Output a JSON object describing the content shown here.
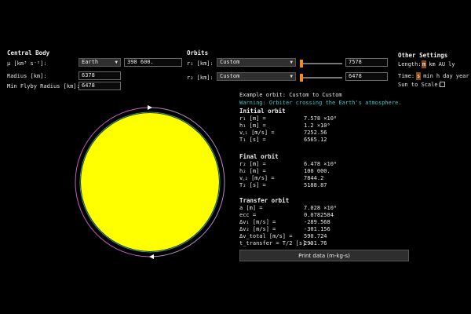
{
  "central_body": {
    "header": "Central Body",
    "mu_label": "μ [km³ s⁻²]:",
    "body_selected": "Earth",
    "mu_value": "398 600.",
    "radius_label": "Radius [km]:",
    "radius_value": "6378",
    "flyby_label": "Min Flyby Radius [km]:",
    "flyby_value": "6478"
  },
  "orbits": {
    "header": "Orbits",
    "r1_label": "r₁ [km]:",
    "r1_preset": "Custom",
    "r1_value": "7578",
    "r2_label": "r₂ [km]:",
    "r2_preset": "Custom",
    "r2_value": "6478"
  },
  "other": {
    "header": "Other Settings",
    "length_label": "Length:",
    "length_units": [
      "m",
      "km",
      "AU",
      "ly"
    ],
    "length_selected": "m",
    "time_label": "Time:",
    "time_units": [
      "s",
      "min",
      "h",
      "day",
      "year"
    ],
    "time_selected": "s",
    "sun_label": "Sun to Scale:",
    "sun_checked": false
  },
  "results": {
    "example": "Example orbit: Custom to Custom",
    "warning": "Warning: Orbiter crossing the Earth's atmosphere.",
    "initial": {
      "header": "Initial orbit",
      "rows": [
        {
          "k": "r₁ [m] =",
          "v": "7.578 ×10⁶"
        },
        {
          "k": "h₁ [m] =",
          "v": "1.2 ×10⁶"
        },
        {
          "k": "v꜀₁ [m/s] =",
          "v": "7252.56"
        },
        {
          "k": "T₁ [s] =",
          "v": "6565.12"
        }
      ]
    },
    "final": {
      "header": "Final orbit",
      "rows": [
        {
          "k": "r₂ [m] =",
          "v": "6.478 ×10⁶"
        },
        {
          "k": "h₂ [m] =",
          "v": "100 000."
        },
        {
          "k": "v꜀₂ [m/s] =",
          "v": "7844.2"
        },
        {
          "k": "T₂ [s] =",
          "v": "5188.87"
        }
      ]
    },
    "transfer": {
      "header": "Transfer orbit",
      "rows": [
        {
          "k": "a [m] =",
          "v": "7.028 ×10⁶"
        },
        {
          "k": "ecc =",
          "v": "0.0782584"
        },
        {
          "k": "Δv₁ [m/s] =",
          "v": "-289.568"
        },
        {
          "k": "Δv₂ [m/s] =",
          "v": "-301.156"
        },
        {
          "k": "Δv_total [m/s] =",
          "v": "590.724"
        },
        {
          "k": "t_transfer = T/2 [s] =",
          "v": "2931.76"
        }
      ]
    },
    "print_label": "Print data (m-kg-s)"
  },
  "colors": {
    "planet": "#ffff00",
    "outer_orbit": "#c060c0",
    "inner_orbit": "#2e9ca0",
    "slider": "#f28c28",
    "warning": "#2ec9c9"
  }
}
